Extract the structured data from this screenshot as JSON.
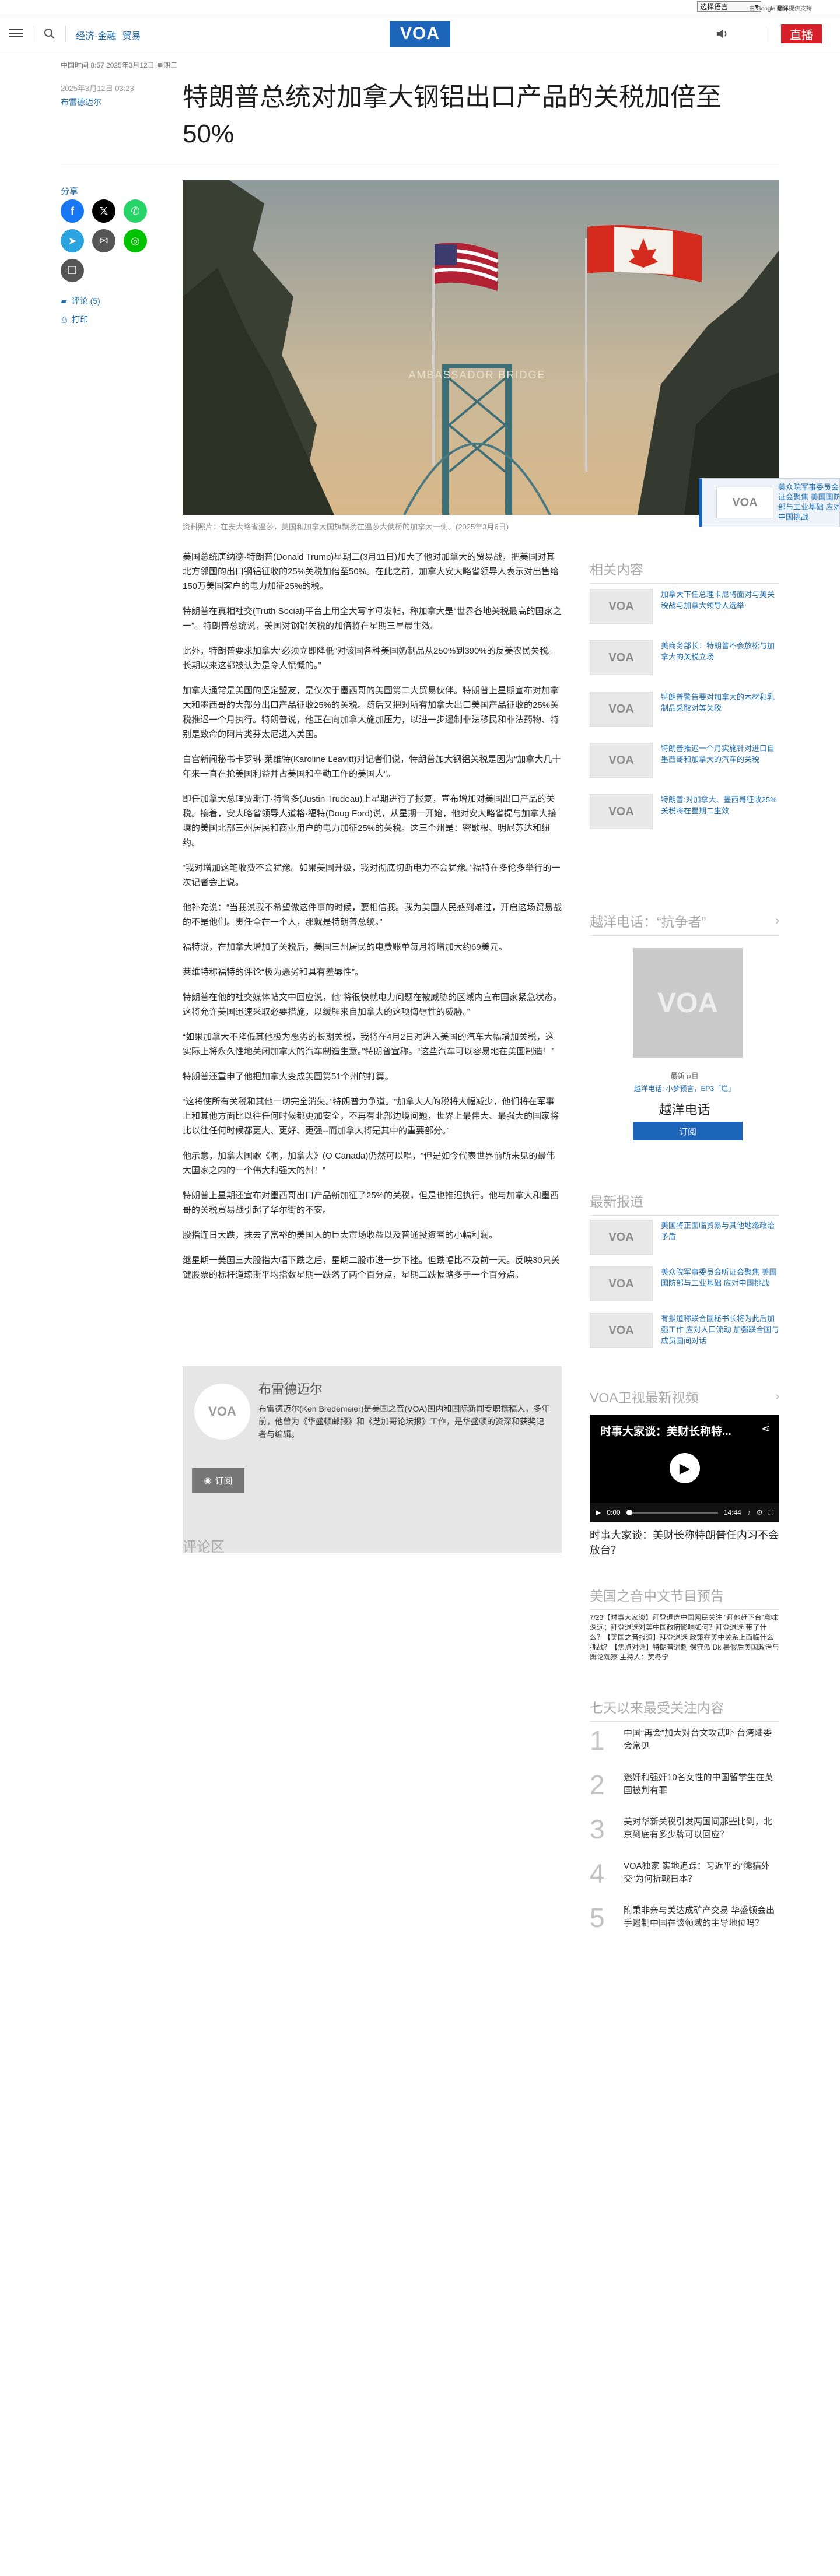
{
  "top": {
    "lang_select": "选择语言",
    "powered_by": "由 Google",
    "translate": "翻译",
    "powered_suffix": "提供支持"
  },
  "nav": {
    "links": [
      "经济·金融",
      "贸易"
    ],
    "logo": "VOA",
    "live": "直播"
  },
  "article": {
    "dateline": "中国时间 8:57 2025年3月12日 星期三",
    "time": "2025年3月12日 03:23",
    "author": "布雷德迈尔",
    "title": "特朗普总统对加拿大钢铝出口产品的关税加倍至50%",
    "share_label": "分享",
    "comments_link": "评论 (5)",
    "print_link": "打印",
    "hero_sign": "AMBASSADOR BRIDGE",
    "caption": "资料照片：在安大略省温莎，美国和加拿大国旗飘扬在温莎大使桥的加拿大一侧。(2025年3月6日)",
    "paragraphs": [
      "美国总统唐纳德·特朗普(Donald Trump)星期二(3月11日)加大了他对加拿大的贸易战，把美国对其北方邻国的出口钢铝征收的25%关税加倍至50%。在此之前，加拿大安大略省领导人表示对出售给150万美国客户的电力加征25%的税。",
      "特朗普在真相社交(Truth Social)平台上用全大写字母发帖，称加拿大是“世界各地关税最高的国家之一”。特朗普总统说，美国对钢铝关税的加倍将在星期三早晨生效。",
      "此外，特朗普要求加拿大“必须立即降低”对该国各种美国奶制品从250%到390%的反美农民关税。长期以来这都被认为是令人愤慨的。”",
      "加拿大通常是美国的坚定盟友，是仅次于墨西哥的美国第二大贸易伙伴。特朗普上星期宣布对加拿大和墨西哥的大部分出口产品征收25%的关税。随后又把对所有加拿大出口美国产品征收的25%关税推迟一个月执行。特朗普说，他正在向加拿大施加压力，以进一步遏制非法移民和非法药物、特别是致命的阿片类芬太尼进入美国。",
      "白宫新闻秘书卡罗琳·莱维特(Karoline Leavitt)对记者们说，特朗普加大钢铝关税是因为“加拿大几十年来一直在抢美国利益并占美国和辛勤工作的美国人”。",
      "即任加拿大总理贾斯汀·特鲁多(Justin Trudeau)上星期进行了报复，宣布增加对美国出口产品的关税。接着，安大略省领导人道格·福特(Doug Ford)说，从星期一开始，他对安大略省提与加拿大接壤的美国北部三州居民和商业用户的电力加征25%的关税。这三个州是：密歇根、明尼苏达和纽约。",
      "“我对增加这笔收费不会犹豫。如果美国升级，我对彻底切断电力不会犹豫。”福特在多伦多举行的一次记者会上说。",
      "他补充说：“当我说我不希望做这件事的时候，要相信我。我为美国人民感到难过，开启这场贸易战的不是他们。责任全在一个人，那就是特朗普总统。”",
      "福特说，在加拿大增加了关税后，美国三州居民的电费账单每月将增加大约69美元。",
      "莱维特称福特的评论“极为恶劣和具有羞辱性”。",
      "特朗普在他的社交媒体帖文中回应说，他“将很快就电力问题在被威胁的区域内宣布国家紧急状态。这将允许美国迅速采取必要措施，以缓解来自加拿大的这项侮辱性的威胁。”",
      "“如果加拿大不降低其他极为恶劣的长期关税，我将在4月2日对进入美国的汽车大幅增加关税，这实际上将永久性地关闭加拿大的汽车制造生意。”特朗普宣称。“这些汽车可以容易地在美国制造！”",
      "特朗普还重申了他把加拿大变成美国第51个州的打算。",
      "“这将使所有关税和其他一切完全消失。”特朗普力争道。“加拿大人的税将大幅减少，他们将在军事上和其他方面比以往任何时候都更加安全，不再有北部边境问题，世界上最伟大、最强大的国家将比以往任何时候都更大、更好、更强--而加拿大将是其中的重要部分。”",
      "他示意，加拿大国歌《啊，加拿大》(O Canada)仍然可以唱，“但是如今代表世界前所未见的最伟大国家之内的一个伟大和强大的州！”",
      "特朗普上星期还宣布对墨西哥出口产品新加征了25%的关税，但是也推迟执行。他与加拿大和墨西哥的关税贸易战引起了华尔街的不安。",
      "股指连日大跌，抹去了富裕的美国人的巨大市场收益以及普通投资者的小幅利润。",
      "继星期一美国三大股指大幅下跌之后，星期二股市进一步下挫。但跌幅比不及前一天。反映30只关键股票的标杆道琼斯平均指数星期一跌落了两个百分点，星期二跌幅略多于一个百分点。"
    ]
  },
  "author_box": {
    "name": "布雷德迈尔",
    "bio": "布雷德迈尔(Ken Bredemeier)是美国之音(VOA)国内和国际新闻专职撰稿人。多年前，他曾为《华盛顿邮报》和《芝加哥论坛报》工作，是华盛顿的资深和获奖记者与编辑。",
    "subscribe": "订阅"
  },
  "comments_title": "评论区",
  "rail": {
    "related_title": "相关内容",
    "related": [
      "加拿大下任总理卡尼将面对与美关税战与加拿大领导人选举",
      "美商务部长：特朗普不会放松与加拿大的关税立场",
      "特朗普警告要对加拿大的木材和乳制品采取对等关税",
      "特朗普推迟一个月实施针对进口自墨西哥和加拿大的汽车的关税",
      "特朗普:对加拿大、墨西哥征收25%关税将在星期二生效"
    ],
    "podcast_title": "越洋电话：“抗争者”",
    "podcast_label": "最新节目",
    "podcast_host": "越洋电话: 小梦预言，EP3「烂」",
    "podcast_name": "越洋电话",
    "podcast_subscribe": "订阅",
    "latest_title": "最新报道",
    "latest": [
      "美国将正面临贸易与其他地缘政治矛盾",
      "美众院军事委员会听证会聚焦 美国国防部与工业基础 应对中国挑战",
      "有报道称联合国秘书长将为此后加强工作 应对人口流动 加强联合国与成员国间对话"
    ],
    "tv_title": "VOA卫视最新视频",
    "video_title": "时事大家谈：美财长称特...",
    "video_time": "0:00",
    "video_duration": "14:44",
    "video_caption": "时事大家谈：美财长称特朗普任内习不会放台？",
    "schedule_title": "美国之音中文节目预告",
    "schedule_text": "7/23【时事大家谈】拜登退选中国网民关注 “拜他赶下台”意味深远；拜登退选对美中国政府影响如何？拜登退选 带了什么？【美国之音报道】拜登退选 政策在美中关系上面临什么挑战？【焦点对话】特朗普遇刺 保守派 Dk 暑假后美国政治与舆论观察 主持人：樊冬宁",
    "popular_title": "七天以来最受关注内容",
    "popular": [
      "中国“再会”加大对台文攻武吓 台湾陆委会常见",
      "迷奸和强奸10名女性的中国留学生在英国被判有罪",
      "美对华新关税引发两国间那些比到，北京到底有多少牌可以回应？",
      "VOA独家 实地追踪：习近平的“熊猫外交”为何折戟日本？",
      "附秉非亲与美达成矿产交易 华盛顿会出手遏制中国在该领域的主导地位吗？"
    ]
  },
  "overlay": {
    "text": "美众院军事委员会听证会聚焦 美国国防部与工业基础 应对中国挑战"
  },
  "colors": {
    "brand_blue": "#1d65b8",
    "link_blue": "#1f6fb5",
    "live_red": "#d8202a"
  },
  "icons": [
    "menu-icon",
    "search-icon",
    "speaker-icon",
    "facebook-icon",
    "x-icon",
    "whatsapp-icon",
    "telegram-icon",
    "email-icon",
    "line-icon",
    "copy-icon",
    "comment-icon",
    "print-icon",
    "rss-icon",
    "play-icon",
    "volume-icon",
    "gear-icon",
    "fullscreen-icon",
    "share-icon",
    "chevron-right-icon"
  ]
}
